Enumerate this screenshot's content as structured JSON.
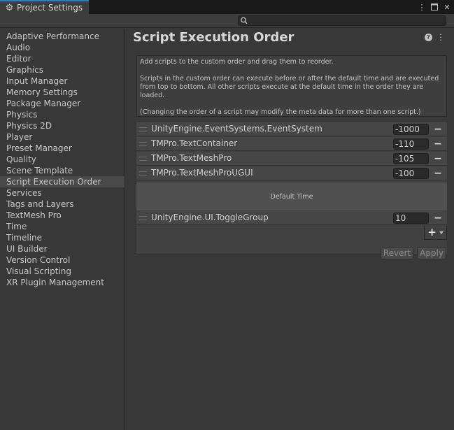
{
  "window": {
    "tab_title": "Project Settings",
    "icons": {
      "tab": "gear-icon",
      "controls": [
        "more-vertical-icon",
        "maximize-icon",
        "close-icon"
      ]
    }
  },
  "search": {
    "placeholder": "",
    "value": ""
  },
  "sidebar": {
    "selected": "Script Execution Order",
    "items": [
      {
        "label": "Adaptive Performance"
      },
      {
        "label": "Audio"
      },
      {
        "label": "Editor"
      },
      {
        "label": "Graphics"
      },
      {
        "label": "Input Manager"
      },
      {
        "label": "Memory Settings"
      },
      {
        "label": "Package Manager"
      },
      {
        "label": "Physics"
      },
      {
        "label": "Physics 2D"
      },
      {
        "label": "Player"
      },
      {
        "label": "Preset Manager"
      },
      {
        "label": "Quality"
      },
      {
        "label": "Scene Template"
      },
      {
        "label": "Script Execution Order"
      },
      {
        "label": "Services"
      },
      {
        "label": "Tags and Layers"
      },
      {
        "label": "TextMesh Pro"
      },
      {
        "label": "Time"
      },
      {
        "label": "Timeline"
      },
      {
        "label": "UI Builder"
      },
      {
        "label": "Version Control"
      },
      {
        "label": "Visual Scripting"
      },
      {
        "label": "XR Plugin Management"
      }
    ]
  },
  "main": {
    "title": "Script Execution Order",
    "help_text": {
      "line1": "Add scripts to the custom order and drag them to reorder.",
      "line2": "Scripts in the custom order can execute before or after the default time and are executed from top to bottom. All other scripts execute at the default time in the order they are loaded.",
      "line3": "(Changing the order of a script may modify the meta data for more than one script.)"
    },
    "scripts_before": [
      {
        "name": "UnityEngine.EventSystems.EventSystem",
        "order": "-1000"
      },
      {
        "name": "TMPro.TextContainer",
        "order": "-110"
      },
      {
        "name": "TMPro.TextMeshPro",
        "order": "-105"
      },
      {
        "name": "TMPro.TextMeshProUGUI",
        "order": "-100"
      }
    ],
    "default_time_label": "Default Time",
    "scripts_after": [
      {
        "name": "UnityEngine.UI.ToggleGroup",
        "order": "10"
      }
    ],
    "remove_label": "−",
    "add_label": "+",
    "buttons": {
      "revert": "Revert",
      "apply": "Apply"
    }
  },
  "colors": {
    "window_bg": "#383838",
    "tab_accent": "#3a79bb",
    "selected_item_bg": "#4a4a4a"
  }
}
